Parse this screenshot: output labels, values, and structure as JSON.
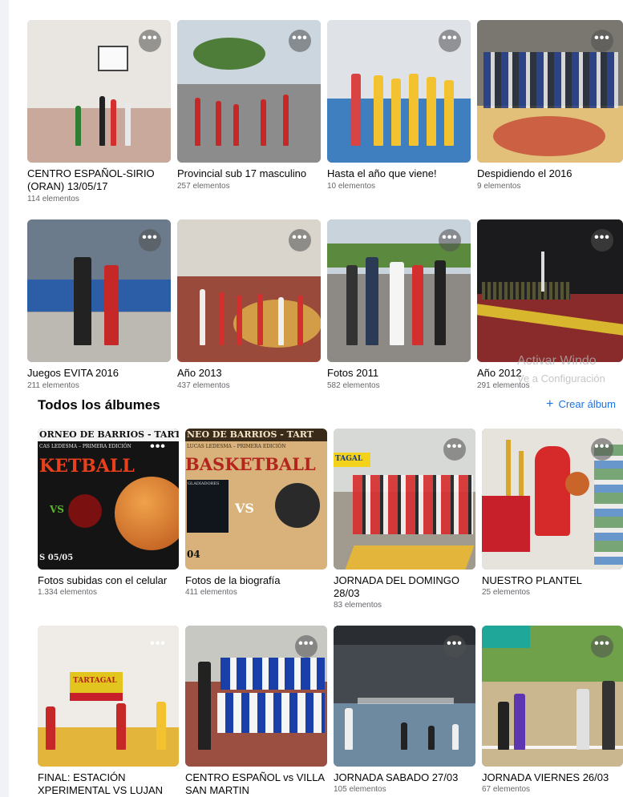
{
  "featured_albums": [
    {
      "title": "CENTRO ESPAÑOL-SIRIO (ORAN) 13/05/17",
      "count": "114 elementos"
    },
    {
      "title": "Provincial sub 17 masculino",
      "count": "257 elementos"
    },
    {
      "title": "Hasta el año que viene!",
      "count": "10 elementos"
    },
    {
      "title": "Despidiendo el 2016",
      "count": "9 elementos"
    },
    {
      "title": "Juegos EVITA 2016",
      "count": "211 elementos"
    },
    {
      "title": "Año 2013",
      "count": "437 elementos"
    },
    {
      "title": "Fotos 2011",
      "count": "582 elementos"
    },
    {
      "title": "Año 2012",
      "count": "291 elementos"
    }
  ],
  "all_albums": {
    "heading": "Todos los álbumes",
    "create_label": "Crear álbum",
    "items": [
      {
        "title": "Fotos subidas con el celular",
        "count": "1.334 elementos"
      },
      {
        "title": "Fotos de la biografía",
        "count": "411 elementos"
      },
      {
        "title": "JORNADA DEL DOMINGO 28/03",
        "count": "83 elementos"
      },
      {
        "title": "NUESTRO PLANTEL",
        "count": "25 elementos"
      },
      {
        "title": "FINAL: ESTACIÓN XPERIMENTAL VS LUJAN",
        "count": ""
      },
      {
        "title": "CENTRO ESPAÑOL vs VILLA SAN MARTIN",
        "count": ""
      },
      {
        "title": "JORNADA SABADO 27/03",
        "count": "105 elementos"
      },
      {
        "title": "JORNADA VIERNES 26/03",
        "count": "67 elementos"
      }
    ]
  },
  "more_button_glyph": "•••",
  "poster_text": {
    "header_1": "ORNEO DE BARRIOS - TARTAGA",
    "sub_1": "CAS LEDESMA – PRIMERA EDICIÓN",
    "sport_1": "KETBALL",
    "vs": "VS",
    "date": "S 05/05",
    "header_2": "NEO DE BARRIOS - TART",
    "sub_2": "LUCAS LEDESMA – PRIMERA EDICIÓN",
    "sport_2": "BASKETBALL",
    "team_label": "GLADIADORES",
    "num": "04",
    "banner": "TARTAGAL",
    "banner_2": "TAGAL"
  },
  "watermark": {
    "line1": "Activar Windo",
    "line2": "Ve a Configuración"
  },
  "icons": {
    "more": "more-horizontal-icon",
    "plus": "plus-icon"
  },
  "colors": {
    "accent": "#1b74e4",
    "secondary_text": "#65676b"
  }
}
